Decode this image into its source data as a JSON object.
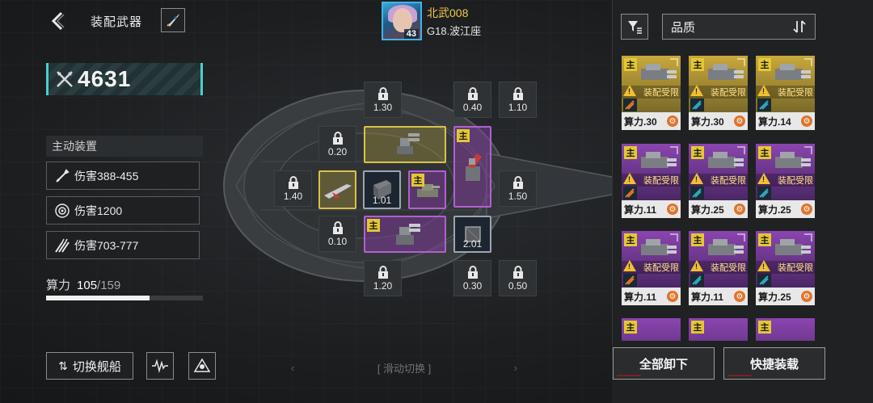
{
  "header": {
    "title": "装配武器",
    "commander_name": "北武008",
    "commander_level": "43",
    "ship_name": "G18.波江座"
  },
  "left_panel": {
    "combat_power": "4631",
    "active_header": "主动装置",
    "abilities": [
      {
        "label": "伤害388-455",
        "icon": "missile-icon"
      },
      {
        "label": "伤害1200",
        "icon": "shield-target-icon"
      },
      {
        "label": "伤害703-777",
        "icon": "multi-strike-icon"
      }
    ],
    "compute_label": "算力",
    "compute_current": "105",
    "compute_max": "/159",
    "compute_fraction": 0.66
  },
  "bottom_left": {
    "switch_ship": "切换舰船",
    "swipe_hint": "滑动切换",
    "swipe_left": "‹",
    "swipe_right": "›"
  },
  "slots": {
    "locked": [
      {
        "value": "1.30"
      },
      {
        "value": "0.40"
      },
      {
        "value": "1.10"
      },
      {
        "value": "0.20"
      },
      {
        "value": "1.40"
      },
      {
        "value": "1.50"
      },
      {
        "value": "0.10"
      },
      {
        "value": "1.20"
      },
      {
        "value": "0.30"
      },
      {
        "value": "0.50"
      }
    ],
    "weapon_values": {
      "dark_center": "1.01",
      "dark_right": "2.01"
    },
    "main_tag": "主"
  },
  "right_panel": {
    "quality_label": "品质",
    "restrict_label": "装配受限",
    "card_tag": "主",
    "cards": [
      {
        "quality": "gold",
        "compute": "算力.30"
      },
      {
        "quality": "gold",
        "compute": "算力.30"
      },
      {
        "quality": "gold",
        "compute": "算力.14"
      },
      {
        "quality": "purple",
        "compute": "算力.11"
      },
      {
        "quality": "purple",
        "compute": "算力.25"
      },
      {
        "quality": "purple",
        "compute": "算力.25"
      },
      {
        "quality": "purple",
        "compute": "算力.11"
      },
      {
        "quality": "purple",
        "compute": "算力.11"
      },
      {
        "quality": "purple",
        "compute": "算力.25"
      }
    ],
    "unequip_all": "全部卸下",
    "quick_equip": "快捷装载"
  },
  "colors": {
    "gold": "#d8c24a",
    "purple": "#b060d0",
    "teal_accent": "#4bd0c8",
    "commander_name": "#f2c94c"
  }
}
